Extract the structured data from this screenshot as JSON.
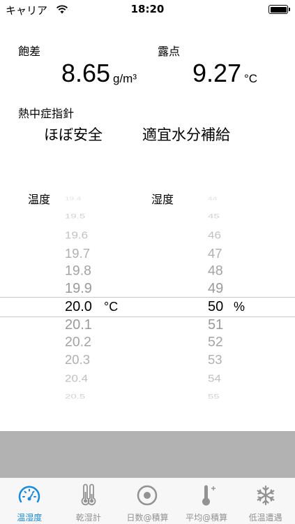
{
  "status_bar": {
    "carrier": "キャリア",
    "time": "18:20"
  },
  "saturation": {
    "label": "飽差",
    "value": "8.65",
    "unit": "g/m³"
  },
  "dew_point": {
    "label": "露点",
    "value": "9.27",
    "unit": "°C"
  },
  "heatstroke": {
    "label": "熱中症指針",
    "level": "ほぼ安全",
    "advice": "適宜水分補給"
  },
  "picker": {
    "temperature_label": "温度",
    "humidity_label": "湿度",
    "temperature_unit": "°C",
    "humidity_unit": "%",
    "temperature_values": [
      "19.4",
      "19.5",
      "19.6",
      "19.7",
      "19.8",
      "19.9",
      "20.0",
      "20.1",
      "20.2",
      "20.3",
      "20.4",
      "20.5"
    ],
    "humidity_values": [
      "44",
      "45",
      "46",
      "47",
      "48",
      "49",
      "50",
      "51",
      "52",
      "53",
      "54",
      "55"
    ],
    "temperature_selected": "20.0",
    "humidity_selected": "50"
  },
  "tabs": [
    {
      "label": "温湿度",
      "icon": "gauge-icon",
      "active": true
    },
    {
      "label": "乾湿計",
      "icon": "thermometer-pair-icon",
      "active": false
    },
    {
      "label": "日数@積算",
      "icon": "target-icon",
      "active": false
    },
    {
      "label": "平均@積算",
      "icon": "thermometer-plus-icon",
      "active": false
    },
    {
      "label": "低温遭遇",
      "icon": "snowflake-icon",
      "active": false
    }
  ],
  "colors": {
    "accent": "#1a8ad9",
    "tab_inactive": "#929292",
    "grey_panel": "#b2b2b2"
  }
}
